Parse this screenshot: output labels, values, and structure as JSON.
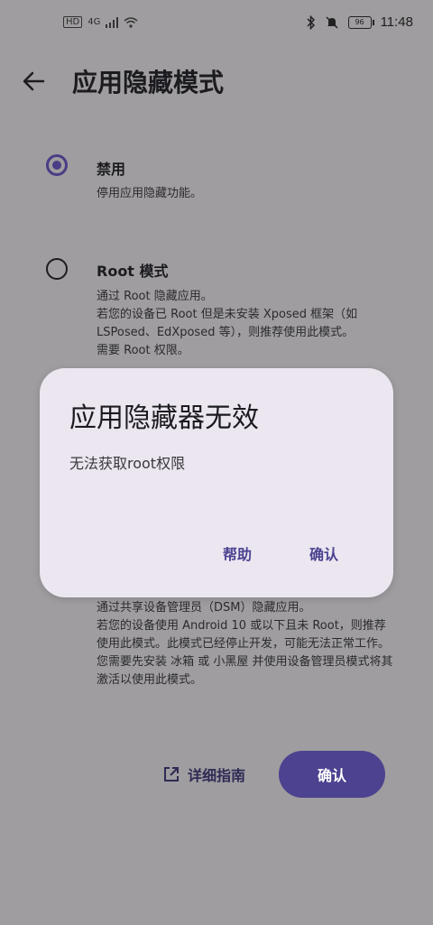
{
  "status_bar": {
    "left_indicators": [
      "HD",
      "4G"
    ],
    "battery": "96",
    "time": "11:48"
  },
  "header": {
    "title": "应用隐藏模式"
  },
  "options": [
    {
      "title": "禁用",
      "description": "停用应用隐藏功能。",
      "selected": true
    },
    {
      "title": "Root 模式",
      "description": "通过 Root 隐藏应用。\n若您的设备已 Root 但是未安装 Xposed 框架（如 LSPosed、EdXposed 等），则推荐使用此模式。\n需要 Root 权限。",
      "selected": false
    },
    {
      "title": "",
      "description": "通过共享设备管理员（DSM）隐藏应用。\n若您的设备使用 Android 10 或以下且未 Root，则推荐使用此模式。此模式已经停止开发，可能无法正常工作。您需要先安装 冰箱 或 小黑屋 并使用设备管理员模式将其激活以使用此模式。",
      "selected": false
    }
  ],
  "dialog": {
    "title": "应用隐藏器无效",
    "message": "无法获取root权限",
    "help_label": "帮助",
    "ok_label": "确认"
  },
  "footer": {
    "guide_label": "详细指南",
    "confirm_label": "确认"
  },
  "colors": {
    "accent": "#4c4290",
    "dialog_bg": "#ebe6f0",
    "scrim_bg": "#9f9d9f"
  }
}
